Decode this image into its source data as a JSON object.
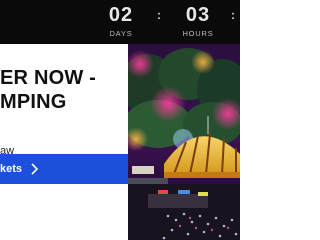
{
  "countdown": {
    "days": {
      "value": "02",
      "label": "DAYS"
    },
    "hours": {
      "value": "03",
      "label": "HOURS"
    },
    "separator": ":"
  },
  "promo": {
    "headline_line1": "ER NOW -",
    "headline_line2": "MPING",
    "subtext": "aw",
    "cta_label": "kets",
    "cta_icon": "chevron-right-icon"
  },
  "colors": {
    "accent": "#1b4fdc",
    "countdown_bg": "#0a0a0a",
    "tent_yellow": "#f2c23a"
  }
}
